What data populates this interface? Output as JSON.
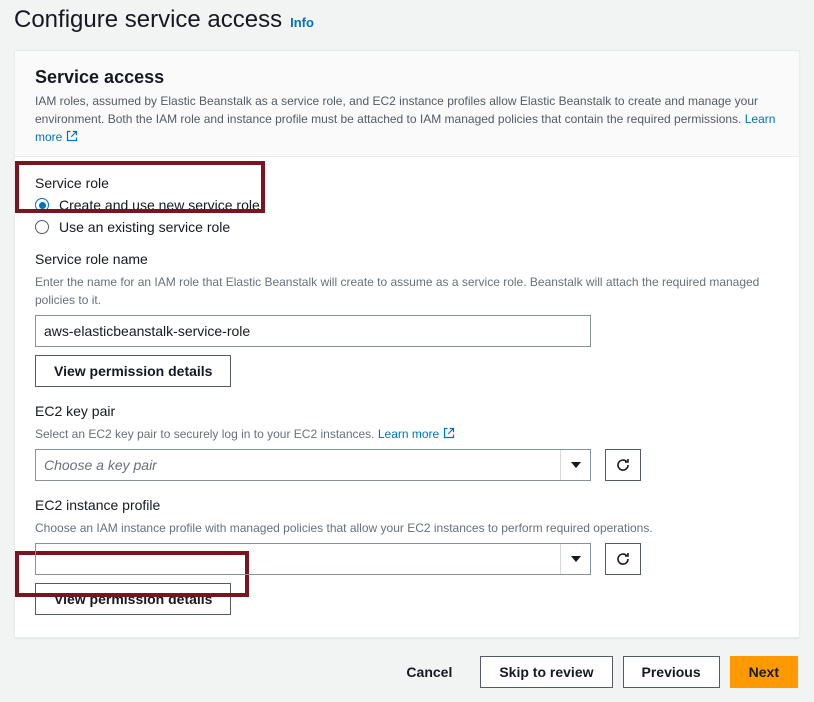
{
  "header": {
    "title": "Configure service access",
    "info": "Info"
  },
  "panel": {
    "title": "Service access",
    "description": "IAM roles, assumed by Elastic Beanstalk as a service role, and EC2 instance profiles allow Elastic Beanstalk to create and manage your environment. Both the IAM role and instance profile must be attached to IAM managed policies that contain the required permissions. ",
    "learn_more": "Learn more"
  },
  "service_role": {
    "label": "Service role",
    "option_create": "Create and use new service role",
    "option_existing": "Use an existing service role",
    "name_label": "Service role name",
    "name_help": "Enter the name for an IAM role that Elastic Beanstalk will create to assume as a service role. Beanstalk will attach the required managed policies to it.",
    "name_value": "aws-elasticbeanstalk-service-role",
    "view_permissions": "View permission details"
  },
  "ec2_keypair": {
    "label": "EC2 key pair",
    "help": "Select an EC2 key pair to securely log in to your EC2 instances. ",
    "learn_more": "Learn more",
    "placeholder": "Choose a key pair"
  },
  "instance_profile": {
    "label": "EC2 instance profile",
    "help": "Choose an IAM instance profile with managed policies that allow your EC2 instances to perform required operations.",
    "view_permissions": "View permission details"
  },
  "footer": {
    "cancel": "Cancel",
    "skip": "Skip to review",
    "previous": "Previous",
    "next": "Next"
  }
}
